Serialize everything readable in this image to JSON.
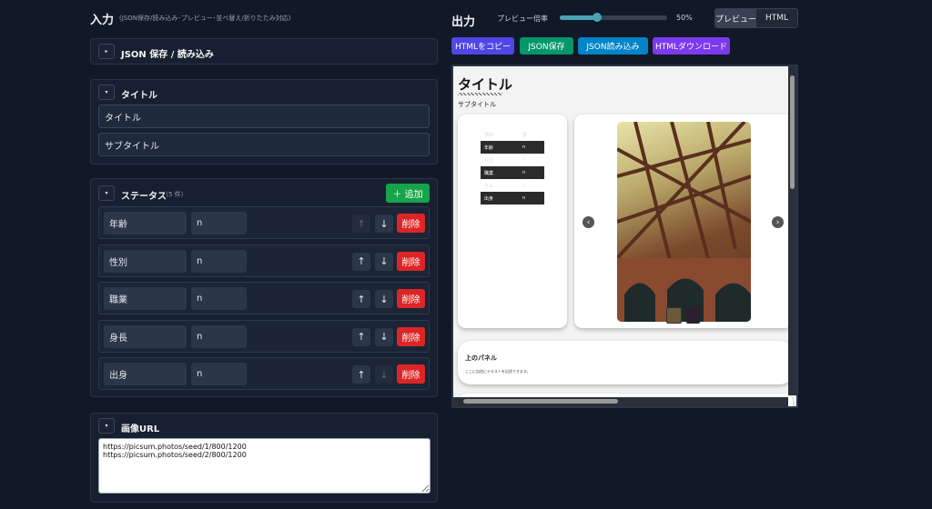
{
  "input": {
    "title": "入力",
    "subtitle": "(JSON保存/読み込み･プレビュー･並べ替え/折りたたみ対応)",
    "json_section": {
      "title": "JSON 保存 / 読み込み",
      "toggle": "▸"
    },
    "title_section": {
      "title": "タイトル",
      "toggle": "▾",
      "title_value": "タイトル",
      "subtitle_value": "サブタイトル"
    },
    "status_section": {
      "title": "ステータス",
      "count": "（5 件）",
      "toggle": "▾",
      "add_label": "＋ 追加",
      "rows": [
        {
          "label": "年齢",
          "value": "n"
        },
        {
          "label": "性別",
          "value": "n"
        },
        {
          "label": "職業",
          "value": "n"
        },
        {
          "label": "身長",
          "value": "n"
        },
        {
          "label": "出身",
          "value": "n"
        }
      ],
      "up": "↑",
      "down": "↓",
      "delete": "削除"
    },
    "image_section": {
      "title": "画像URL",
      "toggle": "▾",
      "value": "https://picsum.photos/seed/1/800/1200\nhttps://picsum.photos/seed/2/800/1200"
    }
  },
  "output": {
    "title": "出力",
    "zoom_label": "プレビュー倍率",
    "zoom_value": "50%",
    "zoom_percent": 50,
    "tabs": [
      "プレビュー",
      "HTML"
    ],
    "buttons": {
      "copy": "HTMLをコピー",
      "save": "JSON保存",
      "load": "JSON読み込み",
      "download": "HTMLダウンロード"
    },
    "colors": {
      "copy": "#4f46e5",
      "save": "#059669",
      "load": "#0284c7",
      "download": "#7c3aed"
    },
    "preview": {
      "title": "タイトル",
      "subtitle": "サブタイトル",
      "table": {
        "headers": [
          "項目",
          "値"
        ],
        "rows": [
          [
            "年齢",
            "n"
          ],
          [
            "性別",
            "n"
          ],
          [
            "職業",
            "n"
          ],
          [
            "身長",
            "n"
          ],
          [
            "出身",
            "n"
          ]
        ]
      },
      "prev": "‹",
      "next": "›",
      "panel_title": "上のパネル",
      "panel_text": "ここに自由にテキストを記述できます。"
    }
  }
}
